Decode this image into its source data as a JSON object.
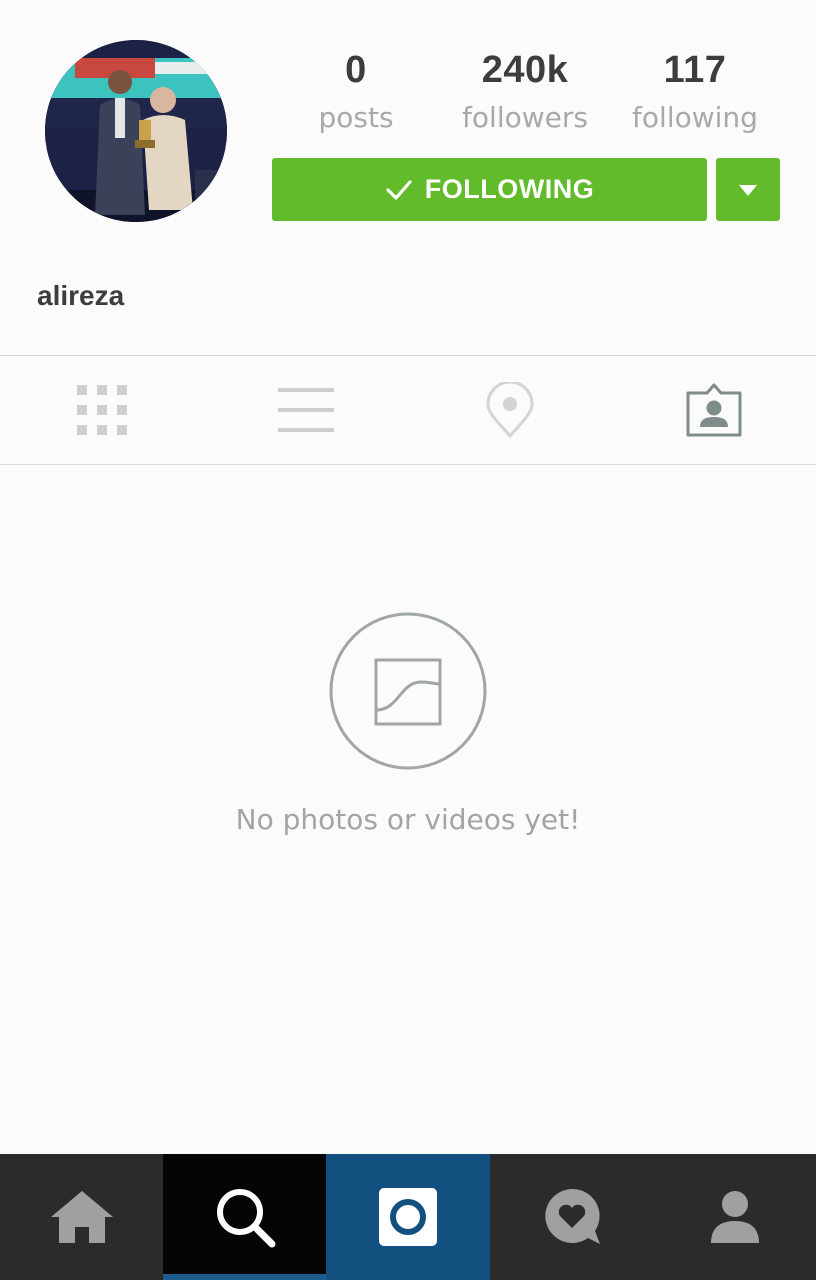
{
  "profile": {
    "username": "alireza",
    "avatar": "profile-photo"
  },
  "stats": [
    {
      "value": "0",
      "label": "posts"
    },
    {
      "value": "240k",
      "label": "followers"
    },
    {
      "value": "117",
      "label": "following"
    }
  ],
  "follow_button": {
    "label": "FOLLOWING",
    "icon": "checkmark-icon"
  },
  "tabs": [
    {
      "name": "grid-view",
      "icon": "grid-icon",
      "selected": false
    },
    {
      "name": "list-view",
      "icon": "list-icon",
      "selected": false
    },
    {
      "name": "photo-map",
      "icon": "location-pin-icon",
      "selected": false
    },
    {
      "name": "tagged-photos",
      "icon": "tagged-person-icon",
      "selected": true
    }
  ],
  "empty_state": {
    "message": "No photos or videos yet!",
    "icon": "photo-icon"
  },
  "bottom_nav": [
    {
      "name": "home",
      "icon": "home-icon"
    },
    {
      "name": "search",
      "icon": "search-icon",
      "active": true
    },
    {
      "name": "camera",
      "icon": "camera-icon"
    },
    {
      "name": "activity",
      "icon": "heart-bubble-icon"
    },
    {
      "name": "profile",
      "icon": "person-icon"
    }
  ],
  "colors": {
    "follow_green": "#62bb2b",
    "nav_dark": "#2b2b2b",
    "nav_active_search": "#050505",
    "nav_camera_blue": "#12507f",
    "search_underline": "#1d5b8a"
  }
}
